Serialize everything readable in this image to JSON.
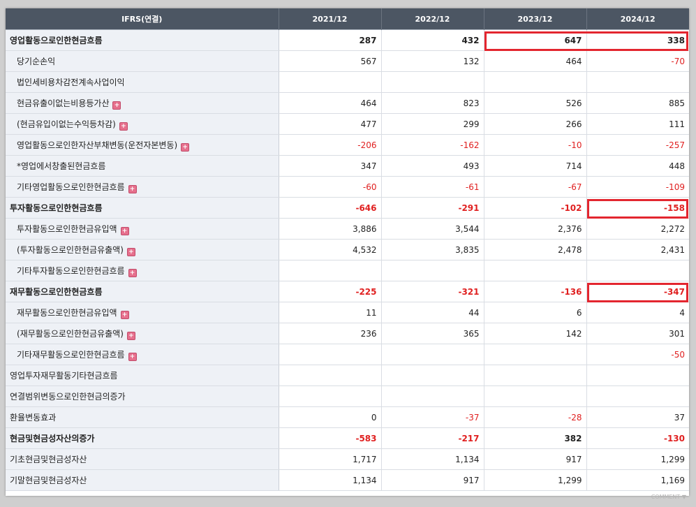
{
  "headers": [
    "IFRS(연결)",
    "2021/12",
    "2022/12",
    "2023/12",
    "2024/12"
  ],
  "rows": [
    {
      "label": "영업활동으로인한현금흐름",
      "main": true,
      "values": [
        "287",
        "432",
        "647",
        "338"
      ]
    },
    {
      "label": "당기순손익",
      "indent": true,
      "values": [
        "567",
        "132",
        "464",
        "-70"
      ]
    },
    {
      "label": "법인세비용차감전계속사업이익",
      "indent": true,
      "values": [
        "",
        "",
        "",
        ""
      ]
    },
    {
      "label": "현금유출이없는비용등가산",
      "indent": true,
      "expand": true,
      "values": [
        "464",
        "823",
        "526",
        "885"
      ]
    },
    {
      "label": "(현금유입이없는수익등차감)",
      "indent": true,
      "expand": true,
      "values": [
        "477",
        "299",
        "266",
        "111"
      ]
    },
    {
      "label": "영업활동으로인한자산부채변동(운전자본변동)",
      "indent": true,
      "expand": true,
      "values": [
        "-206",
        "-162",
        "-10",
        "-257"
      ]
    },
    {
      "label": "*영업에서창출된현금흐름",
      "indent": true,
      "values": [
        "347",
        "493",
        "714",
        "448"
      ]
    },
    {
      "label": "기타영업활동으로인한현금흐름",
      "indent": true,
      "expand": true,
      "values": [
        "-60",
        "-61",
        "-67",
        "-109"
      ]
    },
    {
      "label": "투자활동으로인한현금흐름",
      "main": true,
      "values": [
        "-646",
        "-291",
        "-102",
        "-158"
      ]
    },
    {
      "label": "투자활동으로인한현금유입액",
      "indent": true,
      "expand": true,
      "values": [
        "3,886",
        "3,544",
        "2,376",
        "2,272"
      ]
    },
    {
      "label": "(투자활동으로인한현금유출액)",
      "indent": true,
      "expand": true,
      "values": [
        "4,532",
        "3,835",
        "2,478",
        "2,431"
      ]
    },
    {
      "label": "기타투자활동으로인한현금흐름",
      "indent": true,
      "expand": true,
      "values": [
        "",
        "",
        "",
        ""
      ]
    },
    {
      "label": "재무활동으로인한현금흐름",
      "main": true,
      "values": [
        "-225",
        "-321",
        "-136",
        "-347"
      ]
    },
    {
      "label": "재무활동으로인한현금유입액",
      "indent": true,
      "expand": true,
      "values": [
        "11",
        "44",
        "6",
        "4"
      ]
    },
    {
      "label": "(재무활동으로인한현금유출액)",
      "indent": true,
      "expand": true,
      "values": [
        "236",
        "365",
        "142",
        "301"
      ]
    },
    {
      "label": "기타재무활동으로인한현금흐름",
      "indent": true,
      "expand": true,
      "values": [
        "",
        "",
        "",
        "-50"
      ]
    },
    {
      "label": "영업투자재무활동기타현금흐름",
      "main": false,
      "topline": true,
      "values": [
        "",
        "",
        "",
        ""
      ]
    },
    {
      "label": "연결범위변동으로인한현금의증가",
      "values": [
        "",
        "",
        "",
        ""
      ]
    },
    {
      "label": "환율변동효과",
      "values": [
        "0",
        "-37",
        "-28",
        "37"
      ]
    },
    {
      "label": "현금및현금성자산의증가",
      "main": true,
      "values": [
        "-583",
        "-217",
        "382",
        "-130"
      ]
    },
    {
      "label": "기초현금및현금성자산",
      "values": [
        "1,717",
        "1,134",
        "917",
        "1,299"
      ]
    },
    {
      "label": "기말현금및현금성자산",
      "values": [
        "1,134",
        "917",
        "1,299",
        "1,169"
      ]
    }
  ],
  "highlights": [
    {
      "row": 0,
      "cols": [
        3,
        4
      ]
    },
    {
      "row": 8,
      "cols": [
        4
      ]
    },
    {
      "row": 12,
      "cols": [
        4
      ]
    }
  ],
  "colors": {
    "header": "#4c5663",
    "negative": "#e02020",
    "highlight": "#e3262f",
    "label_bg": "#eef1f6"
  },
  "watermark": "COMMENT ▼"
}
